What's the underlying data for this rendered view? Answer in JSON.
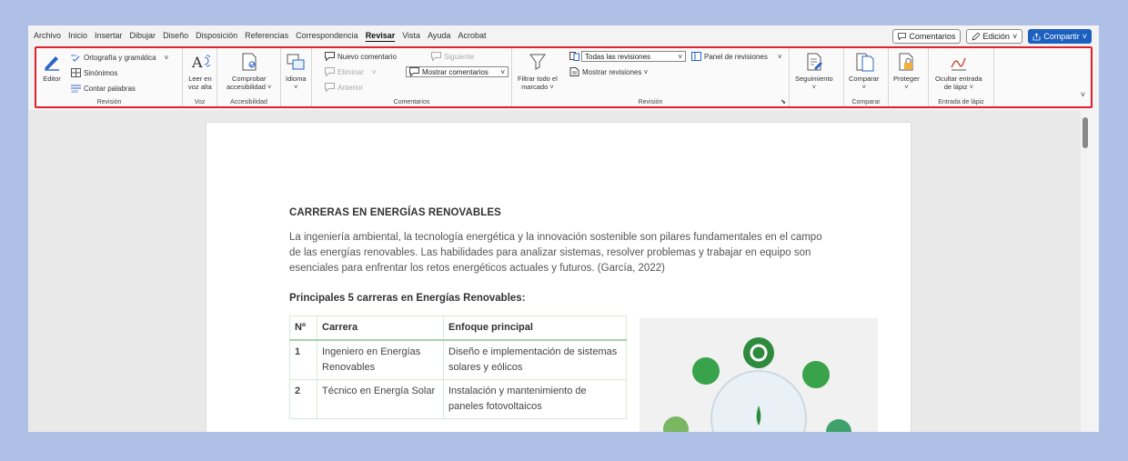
{
  "menu": {
    "tabs": [
      "Archivo",
      "Inicio",
      "Insertar",
      "Dibujar",
      "Diseño",
      "Disposición",
      "Referencias",
      "Correspondencia",
      "Revisar",
      "Vista",
      "Ayuda",
      "Acrobat"
    ],
    "active_tab": "Revisar",
    "comments_button": "Comentarios",
    "edit_button": "Edición",
    "share_button": "Compartir"
  },
  "ribbon": {
    "revision": {
      "label": "Revisión",
      "editor": "Editor",
      "spelling": "Ortografía y gramática",
      "synonyms": "Sinónimos",
      "word_count": "Contar palabras"
    },
    "voz": {
      "label": "Voz",
      "read_aloud_1": "Leer en",
      "read_aloud_2": "voz alta"
    },
    "accesibilidad": {
      "label": "Accesibilidad",
      "check_1": "Comprobar",
      "check_2": "accesibilidad ˅"
    },
    "idioma": {
      "label": "Idioma",
      "arrow": "˅"
    },
    "comentarios": {
      "label": "Comentarios",
      "new": "Nuevo comentario",
      "delete": "Eliminar",
      "previous": "Anterior",
      "next": "Siguiente",
      "show": "Mostrar comentarios"
    },
    "seguimiento_group": {
      "label": "Revisión",
      "filter_1": "Filtrar todo el",
      "filter_2": "marcado ˅",
      "all_revisions": "Todas las revisiones",
      "show_revisions": "Mostrar revisiones ˅",
      "panel": "Panel de revisiones"
    },
    "tracking": {
      "label": "Seguimiento",
      "arrow": "˅"
    },
    "comparar": {
      "label": "Comparar",
      "button": "Comparar",
      "arrow": "˅"
    },
    "proteger": {
      "button": "Proteger",
      "arrow": "˅"
    },
    "tinta": {
      "label": "Entrada de lápiz",
      "hide_1": "Ocultar entrada",
      "hide_2": "de lápiz ˅"
    }
  },
  "document": {
    "title": "CARRERAS EN ENERGÍAS RENOVABLES",
    "paragraph": "La ingeniería ambiental, la tecnología energética y la innovación sostenible son pilares fundamentales en el campo de las energías renovables. Las habilidades para analizar sistemas, resolver problemas y trabajar en equipo son esenciales para enfrentar los retos energéticos actuales y futuros. (García, 2022)",
    "subtitle": "Principales 5 carreras en Energías Renovables:",
    "table": {
      "headers": [
        "Nº",
        "Carrera",
        "Enfoque principal"
      ],
      "rows": [
        [
          "1",
          "Ingeniero en Energías Renovables",
          "Diseño e implementación de sistemas solares y eólicos"
        ],
        [
          "2",
          "Técnico en Energía Solar",
          "Instalación y mantenimiento de paneles fotovoltaicos"
        ]
      ]
    }
  },
  "colors": {
    "accent": "#1b5fbf",
    "highlight_border": "#e0202a"
  }
}
